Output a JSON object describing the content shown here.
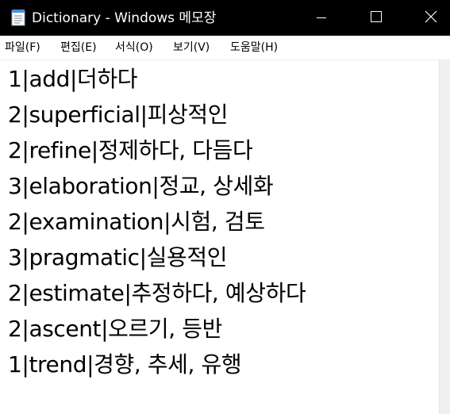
{
  "window": {
    "title": "Dictionary - Windows 메모장"
  },
  "menu": {
    "items": [
      "파일(F)",
      "편집(E)",
      "서식(O)",
      "보기(V)",
      "도움말(H)"
    ]
  },
  "document": {
    "lines": [
      "1|add|더하다",
      "2|superficial|피상적인",
      "2|refine|정제하다, 다듬다",
      "3|elaboration|정교, 상세화",
      "2|examination|시험, 검토",
      "3|pragmatic|실용적인",
      "2|estimate|추정하다, 예상하다",
      "2|ascent|오르기, 등반",
      "1|trend|경향, 추세, 유행"
    ]
  },
  "icons": {
    "app": "notepad-icon",
    "minimize": "minimize-icon",
    "maximize": "maximize-icon",
    "close": "close-icon"
  },
  "colors": {
    "titlebar_bg": "#000000",
    "titlebar_text": "#ffffff",
    "text": "#000000",
    "background": "#ffffff"
  }
}
